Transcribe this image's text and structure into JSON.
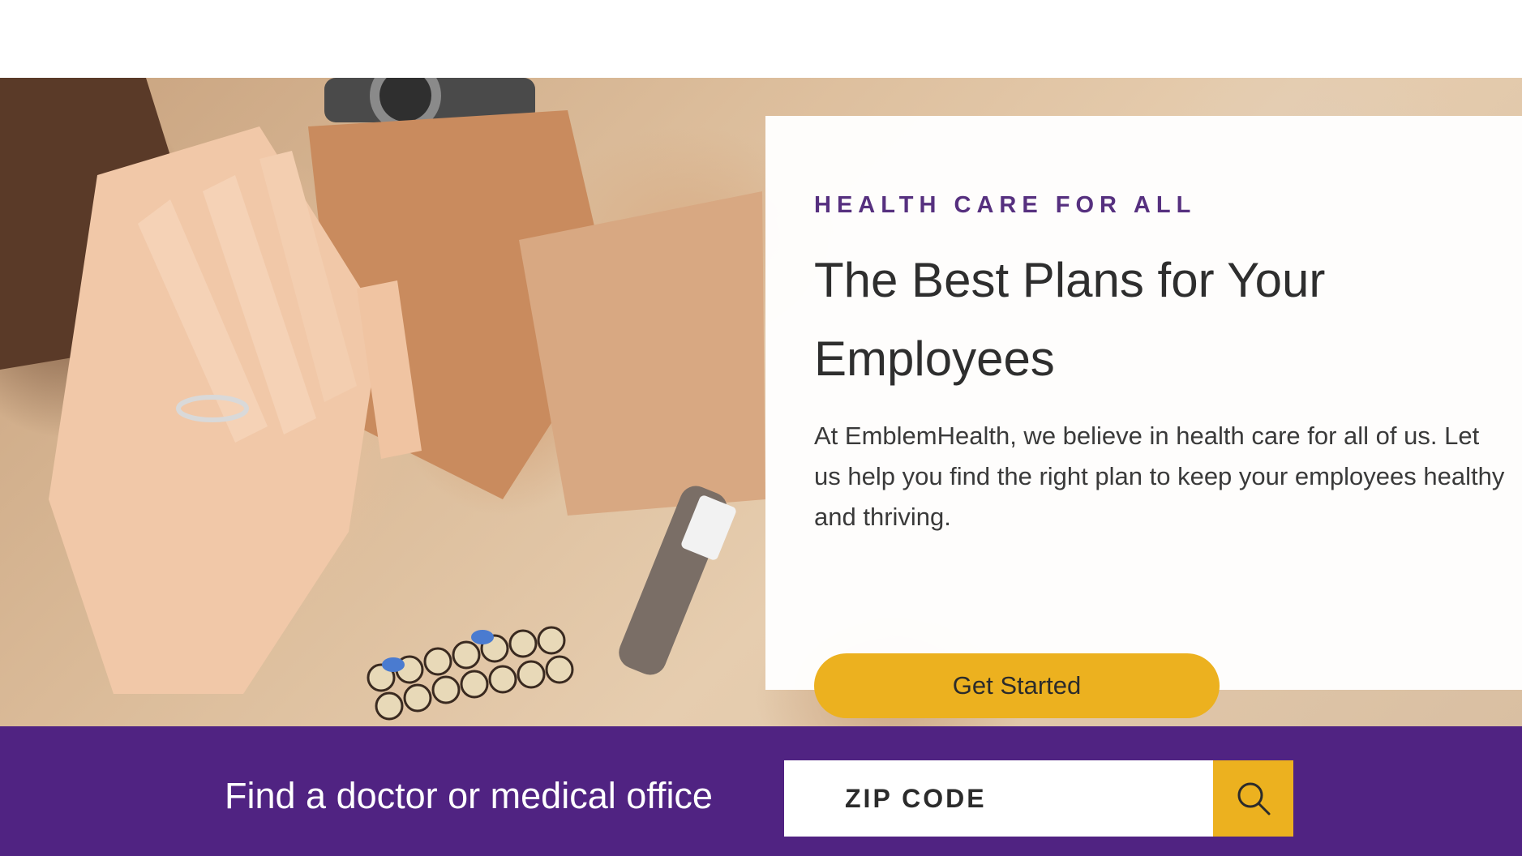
{
  "hero": {
    "eyebrow": "HEALTH CARE FOR ALL",
    "headline": "The Best Plans for Your Employees",
    "body": "At EmblemHealth, we believe in health care for all of us. Let us help you find the right plan to keep your employees healthy and thriving.",
    "cta_label": "Get Started",
    "image_description_icon": "hands-stacked-photo"
  },
  "find_doctor": {
    "label": "Find a doctor or medical office",
    "zip_placeholder": "ZIP CODE",
    "zip_value": "",
    "search_icon": "search-icon"
  },
  "colors": {
    "brand_purple": "#502382",
    "eyebrow_purple": "#56307f",
    "accent_gold": "#ecb11f",
    "headline_text": "#2e2e2e"
  }
}
